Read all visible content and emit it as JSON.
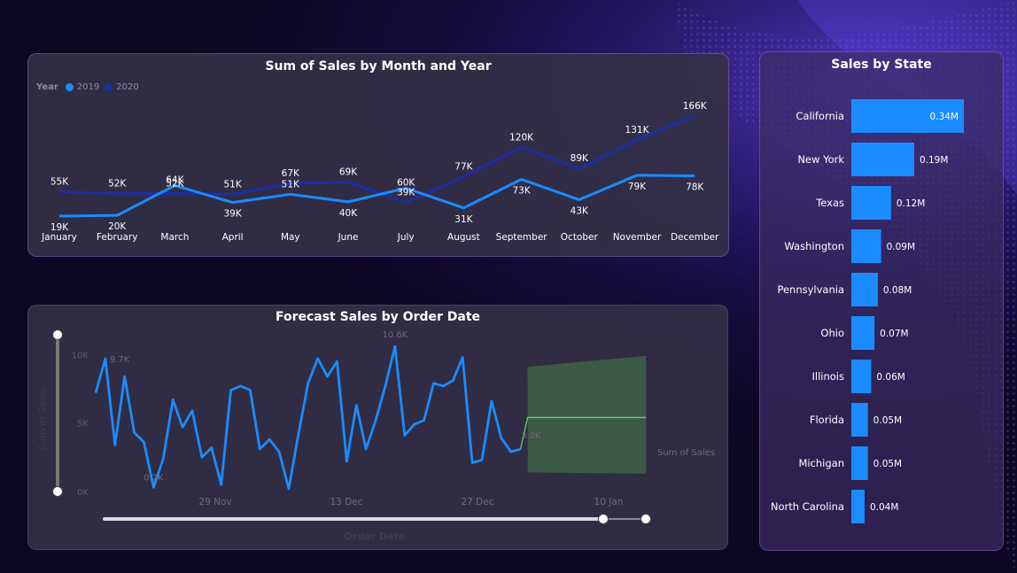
{
  "colors": {
    "series_2019": "#1a8cff",
    "series_2020": "#1c2ea6",
    "state_bar": "#1a8cff",
    "forecast_band": "#3d5c45",
    "forecast_line": "#5fd35f"
  },
  "chart_data": [
    {
      "type": "line",
      "title": "Sum of Sales by Month and Year",
      "legend_title": "Year",
      "legend_position": "top-left",
      "categories": [
        "January",
        "February",
        "March",
        "April",
        "May",
        "June",
        "July",
        "August",
        "September",
        "October",
        "November",
        "December"
      ],
      "series": [
        {
          "name": "2019",
          "values": [
            19,
            20,
            64,
            39,
            51,
            40,
            60,
            31,
            73,
            43,
            79,
            78
          ],
          "labels": [
            "19K",
            "20K",
            "64K",
            "39K",
            "51K",
            "40K",
            "60K",
            "31K",
            "73K",
            "43K",
            "79K",
            "78K"
          ]
        },
        {
          "name": "2020",
          "values": [
            55,
            52,
            52,
            51,
            67,
            69,
            39,
            77,
            120,
            89,
            131,
            166
          ],
          "labels": [
            "55K",
            "52K",
            "52K",
            "51K",
            "67K",
            "69K",
            "39K",
            "77K",
            "120K",
            "89K",
            "131K",
            "166K"
          ]
        }
      ],
      "ylim": [
        0,
        170
      ],
      "unit": "thousands"
    },
    {
      "type": "line",
      "title": "Forecast Sales by Order Date",
      "xlabel": "Order Date",
      "ylabel": "Sum of Sales",
      "series_label": "Sum of Sales",
      "yticks": [
        "0K",
        "5K",
        "10K"
      ],
      "ylim": [
        0,
        10.6
      ],
      "xticks": [
        "29 Nov",
        "13 Dec",
        "27 Dec",
        "10 Jan"
      ],
      "values": [
        7.2,
        9.7,
        3.4,
        8.4,
        4.3,
        3.6,
        0.3,
        2.4,
        6.7,
        4.7,
        5.9,
        2.5,
        3.2,
        0.5,
        7.4,
        7.7,
        7.4,
        3.1,
        3.8,
        2.9,
        0.2,
        4.2,
        7.9,
        9.7,
        8.4,
        9.5,
        2.2,
        6.3,
        3.1,
        5.2,
        7.7,
        10.6,
        4.1,
        4.9,
        5.2,
        7.9,
        7.7,
        8.1,
        9.8,
        2.1,
        2.3,
        6.6,
        3.9,
        2.9,
        3.1
      ],
      "min_label": "0.2K",
      "max_label": "10.6K",
      "first_label": "9.7K",
      "last_label": "3.0K",
      "forecast": {
        "value": 5.4,
        "band_upper": 9.9,
        "band_lower": 1.3,
        "steps": 13
      }
    },
    {
      "type": "bar",
      "orientation": "horizontal",
      "title": "Sales by State",
      "categories": [
        "California",
        "New York",
        "Texas",
        "Washington",
        "Pennsylvania",
        "Ohio",
        "Illinois",
        "Florida",
        "Michigan",
        "North Carolina"
      ],
      "values": [
        0.34,
        0.19,
        0.12,
        0.09,
        0.08,
        0.07,
        0.06,
        0.05,
        0.05,
        0.04
      ],
      "labels": [
        "0.34M",
        "0.19M",
        "0.12M",
        "0.09M",
        "0.08M",
        "0.07M",
        "0.06M",
        "0.05M",
        "0.05M",
        "0.04M"
      ],
      "xlim": [
        0,
        0.34
      ],
      "unit": "millions"
    }
  ]
}
